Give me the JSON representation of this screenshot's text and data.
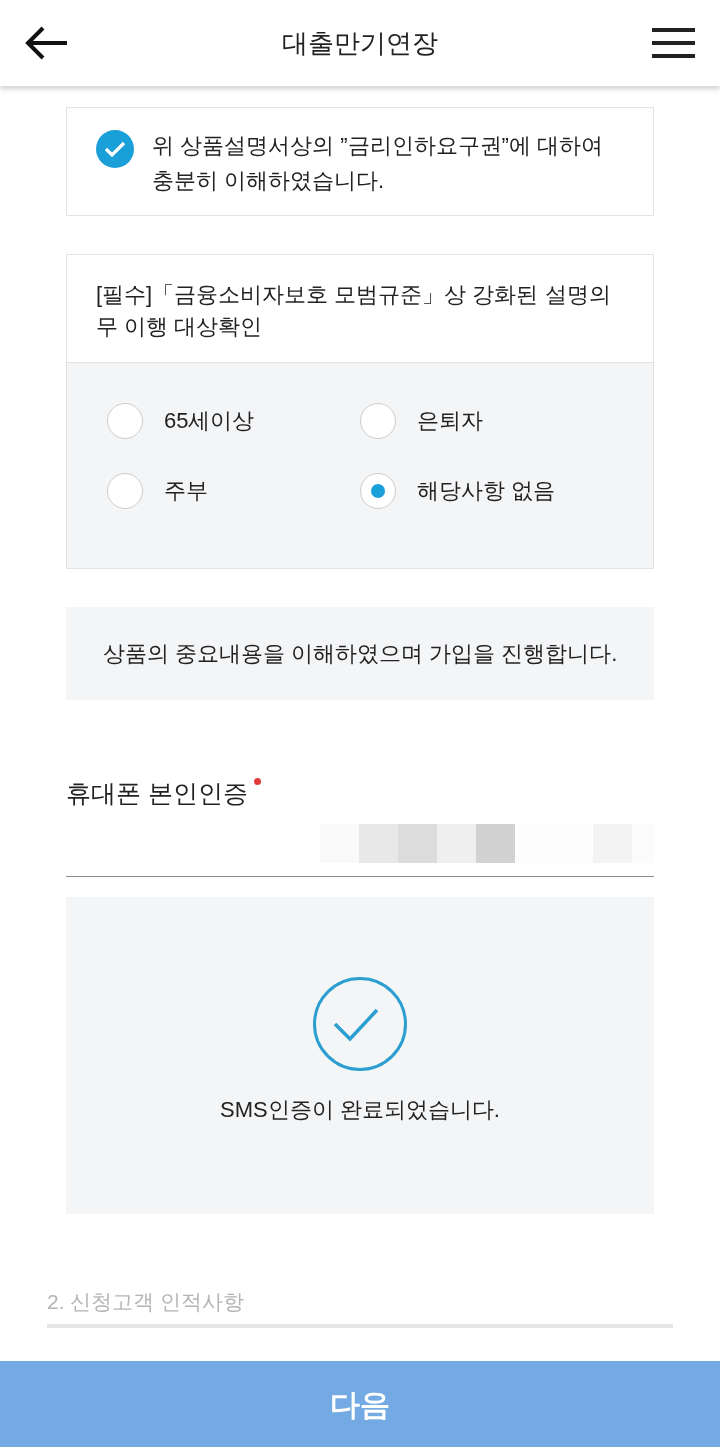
{
  "header": {
    "title": "대출만기연장"
  },
  "agreement": {
    "checked": true,
    "text": "위 상품설명서상의 ”금리인하요구권”에 대하여 충분히 이해하였습니다."
  },
  "target_check": {
    "title": "[필수]「금융소비자보호 모범규준」상 강화된 설명의무 이행 대상확인",
    "options": [
      {
        "label": "65세이상",
        "selected": false
      },
      {
        "label": "은퇴자",
        "selected": false
      },
      {
        "label": "주부",
        "selected": false
      },
      {
        "label": "해당사항 없음",
        "selected": true
      }
    ]
  },
  "notice": "상품의 중요내용을 이해하였으며 가입을 진행합니다.",
  "phone_verification": {
    "label": "휴대폰 본인인증",
    "required": true,
    "verified": true,
    "message": "SMS인증이 완료되었습니다."
  },
  "next_section": {
    "title": "2. 신청고객 인적사항"
  },
  "next_button": "다음"
}
